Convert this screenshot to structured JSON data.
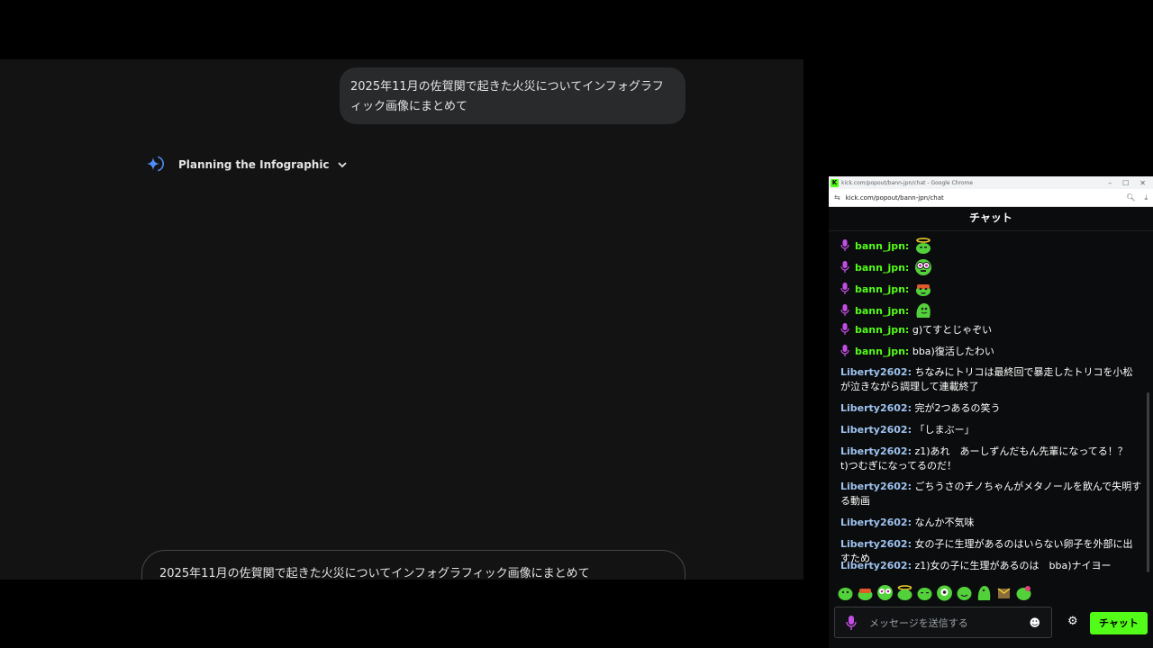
{
  "gemini": {
    "user_prompt": "2025年11月の佐賀関で起きた火災についてインフォグラフィック画像にまとめて",
    "thinking_label": "Planning the Infographic",
    "input_value": "2025年11月の佐賀関で起きた火災についてインフォグラフィック画像にまとめて"
  },
  "browser": {
    "window_title": "kick.com/popout/bann-jpn/chat - Google Chrome",
    "url": "kick.com/popout/bann-jpn/chat"
  },
  "chat": {
    "header": "チャット",
    "messages": [
      {
        "user": "bann_jpn:",
        "text": "",
        "emote": "halo-frog"
      },
      {
        "user": "bann_jpn:",
        "text": "",
        "emote": "goggle-frog"
      },
      {
        "user": "bann_jpn:",
        "text": "",
        "emote": "red-frog"
      },
      {
        "user": "bann_jpn:",
        "text": "",
        "emote": "green-blob"
      },
      {
        "user": "bann_jpn:",
        "text": "g)てすとじゃぞい"
      },
      {
        "user": "bann_jpn:",
        "text": "bba)復活したわい"
      },
      {
        "user": "Liberty2602:",
        "text": "ちなみにトリコは最終回で暴走したトリコを小松が泣きながら調理して連載終了"
      },
      {
        "user": "Liberty2602:",
        "text": "完が2つあるの笑う"
      },
      {
        "user": "Liberty2602:",
        "text": "「しまぶー」"
      },
      {
        "user": "Liberty2602:",
        "text": "z1)あれ　あーしずんだもん先輩になってる！？　t)つむぎになってるのだ！"
      },
      {
        "user": "Liberty2602:",
        "text": "ごちうさのチノちゃんがメタノールを飲んで失明する動画"
      },
      {
        "user": "Liberty2602:",
        "text": "なんか不気味"
      },
      {
        "user": "Liberty2602:",
        "text": "女の子に生理があるのはいらない卵子を外部に出すため"
      },
      {
        "user": "Liberty2602:",
        "text": "z1)女の子に生理があるのは　bba)ナイヨー"
      }
    ],
    "input_placeholder": "メッセージを送信する",
    "send_label": "チャット",
    "accent": "#53fc18"
  }
}
